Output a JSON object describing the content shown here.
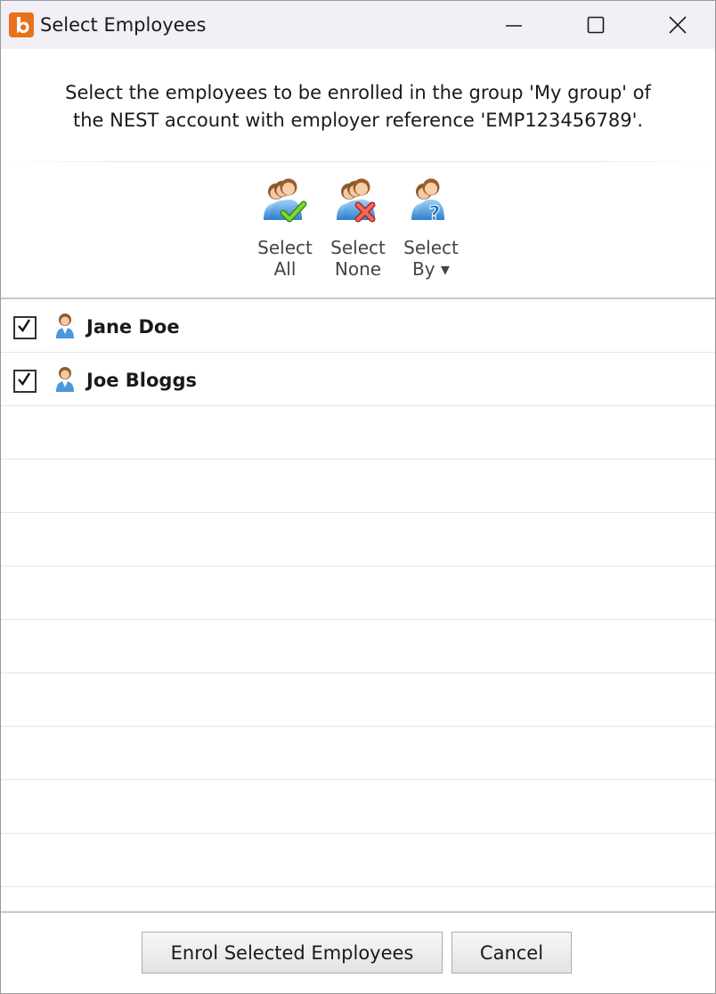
{
  "window": {
    "title": "Select Employees",
    "app_icon": "bright-b-logo-icon",
    "controls": {
      "minimize": "minimize-icon",
      "maximize": "maximize-icon",
      "close": "close-icon"
    }
  },
  "instruction": {
    "line1": "Select the employees to be enrolled in the group 'My group' of",
    "line2": "the NEST account with employer reference 'EMP123456789'."
  },
  "toolbar": {
    "select_all": {
      "line1": "Select",
      "line2": "All",
      "icon": "select-all-people-icon"
    },
    "select_none": {
      "line1": "Select",
      "line2": "None",
      "icon": "select-none-people-icon"
    },
    "select_by": {
      "line1": "Select",
      "line2": "By ▾",
      "icon": "select-by-people-icon"
    }
  },
  "employees": [
    {
      "name": "Jane Doe",
      "checked": true,
      "icon": "person-icon"
    },
    {
      "name": "Joe Bloggs",
      "checked": true,
      "icon": "person-icon"
    }
  ],
  "buttons": {
    "enrol": "Enrol Selected Employees",
    "cancel": "Cancel"
  },
  "colors": {
    "titlebar_bg": "#f3eff6",
    "app_icon": "#e8711c",
    "check_green": "#5cb21e",
    "cross_red": "#e2463c",
    "question_blue": "#2f8fd8"
  }
}
